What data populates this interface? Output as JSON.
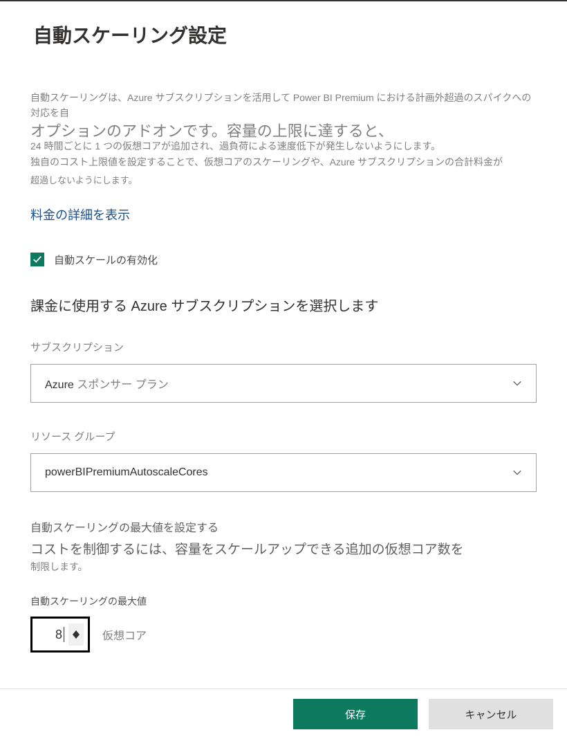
{
  "header": {
    "title": "自動スケーリング設定"
  },
  "description": {
    "line1": "自動スケーリングは、Azure サブスクリプションを活用して Power BI Premium における計画外超過のスパイクへの対応を自",
    "big": "オプションのアドオンです。容量の上限に達すると、",
    "line2": "24 時間ごとに 1 つの仮想コアが追加され、過負荷による速度低下が発生しないようにします。",
    "line3": "独自のコスト上限値を設定することで、仮想コアのスケーリングや、Azure サブスクリプションの合計料金が",
    "line4": "超過しないようにします。"
  },
  "pricing_link": "料金の詳細を表示",
  "checkbox": {
    "label": "自動スケールの有効化",
    "checked": true
  },
  "section_title": "課金に使用する Azure サブスクリプションを選択します",
  "subscription": {
    "label": "サブスクリプション",
    "value_prefix": "Azure",
    "value_suffix": " スポンサー プラン"
  },
  "resource_group": {
    "label": "リソース グループ",
    "value": "powerBIPremiumAutoscaleCores"
  },
  "max_section": {
    "title": "自動スケーリングの最大値を設定する",
    "big": "コストを制御するには、容量をスケールアップできる追加の仮想コア数を",
    "small": "制限します。",
    "label": "自動スケーリングの最大値",
    "value": "8",
    "unit": "仮想コア"
  },
  "footer": {
    "save": "保存",
    "cancel": "キャンセル"
  }
}
